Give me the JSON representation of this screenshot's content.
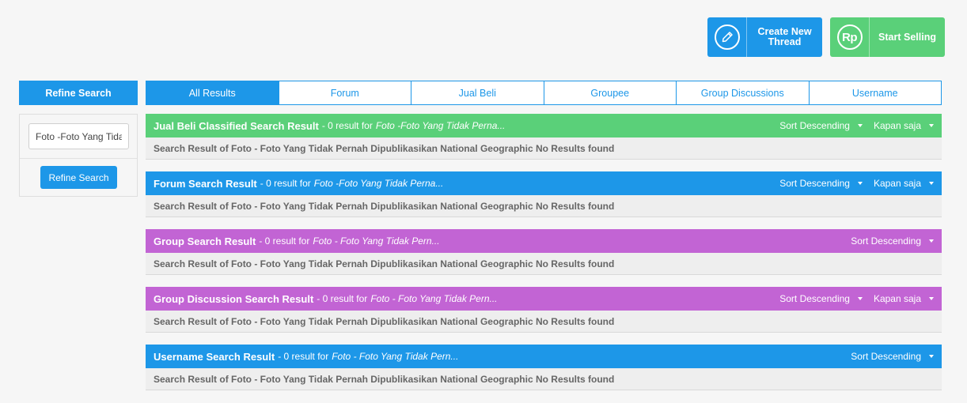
{
  "actions": {
    "create_thread": "Create New Thread",
    "start_selling": "Start Selling",
    "rp_symbol": "Rp"
  },
  "sidebar": {
    "title": "Refine Search",
    "input_value": "Foto -Foto Yang Tidak Pernah Dipublikasikan National Geographic",
    "button": "Refine Search"
  },
  "tabs": [
    "All Results",
    "Forum",
    "Jual Beli",
    "Groupee",
    "Group Discussions",
    "Username"
  ],
  "sections": [
    {
      "title": "Jual Beli Classified Search Result",
      "count": "- 0 result for",
      "query": "Foto -Foto Yang Tidak Perna...",
      "sort": "Sort Descending",
      "time": "Kapan saja",
      "body": "Search Result of Foto - Foto Yang Tidak Pernah Dipublikasikan National Geographic No Results found",
      "color": "#5ad079"
    },
    {
      "title": "Forum Search Result",
      "count": "- 0 result for",
      "query": "Foto -Foto Yang Tidak Perna...",
      "sort": "Sort Descending",
      "time": "Kapan saja",
      "body": "Search Result of Foto - Foto Yang Tidak Pernah Dipublikasikan National Geographic No Results found",
      "color": "#1d97e8"
    },
    {
      "title": "Group Search Result",
      "count": "- 0 result for",
      "query": "Foto - Foto Yang Tidak Pern...",
      "sort": "Sort Descending",
      "body": "Search Result of Foto - Foto Yang Tidak Pernah Dipublikasikan National Geographic No Results found",
      "color": "#c264d4"
    },
    {
      "title": "Group Discussion Search Result",
      "count": "- 0 result for",
      "query": "Foto - Foto Yang Tidak Pern...",
      "sort": "Sort Descending",
      "time": "Kapan saja",
      "body": "Search Result of Foto - Foto Yang Tidak Pernah Dipublikasikan National Geographic No Results found",
      "color": "#c264d4"
    },
    {
      "title": "Username Search Result",
      "count": "- 0 result for",
      "query": "Foto - Foto Yang Tidak Pern...",
      "sort": "Sort Descending",
      "body": "Search Result of Foto - Foto Yang Tidak Pernah Dipublikasikan National Geographic No Results found",
      "color": "#1d97e8"
    }
  ]
}
